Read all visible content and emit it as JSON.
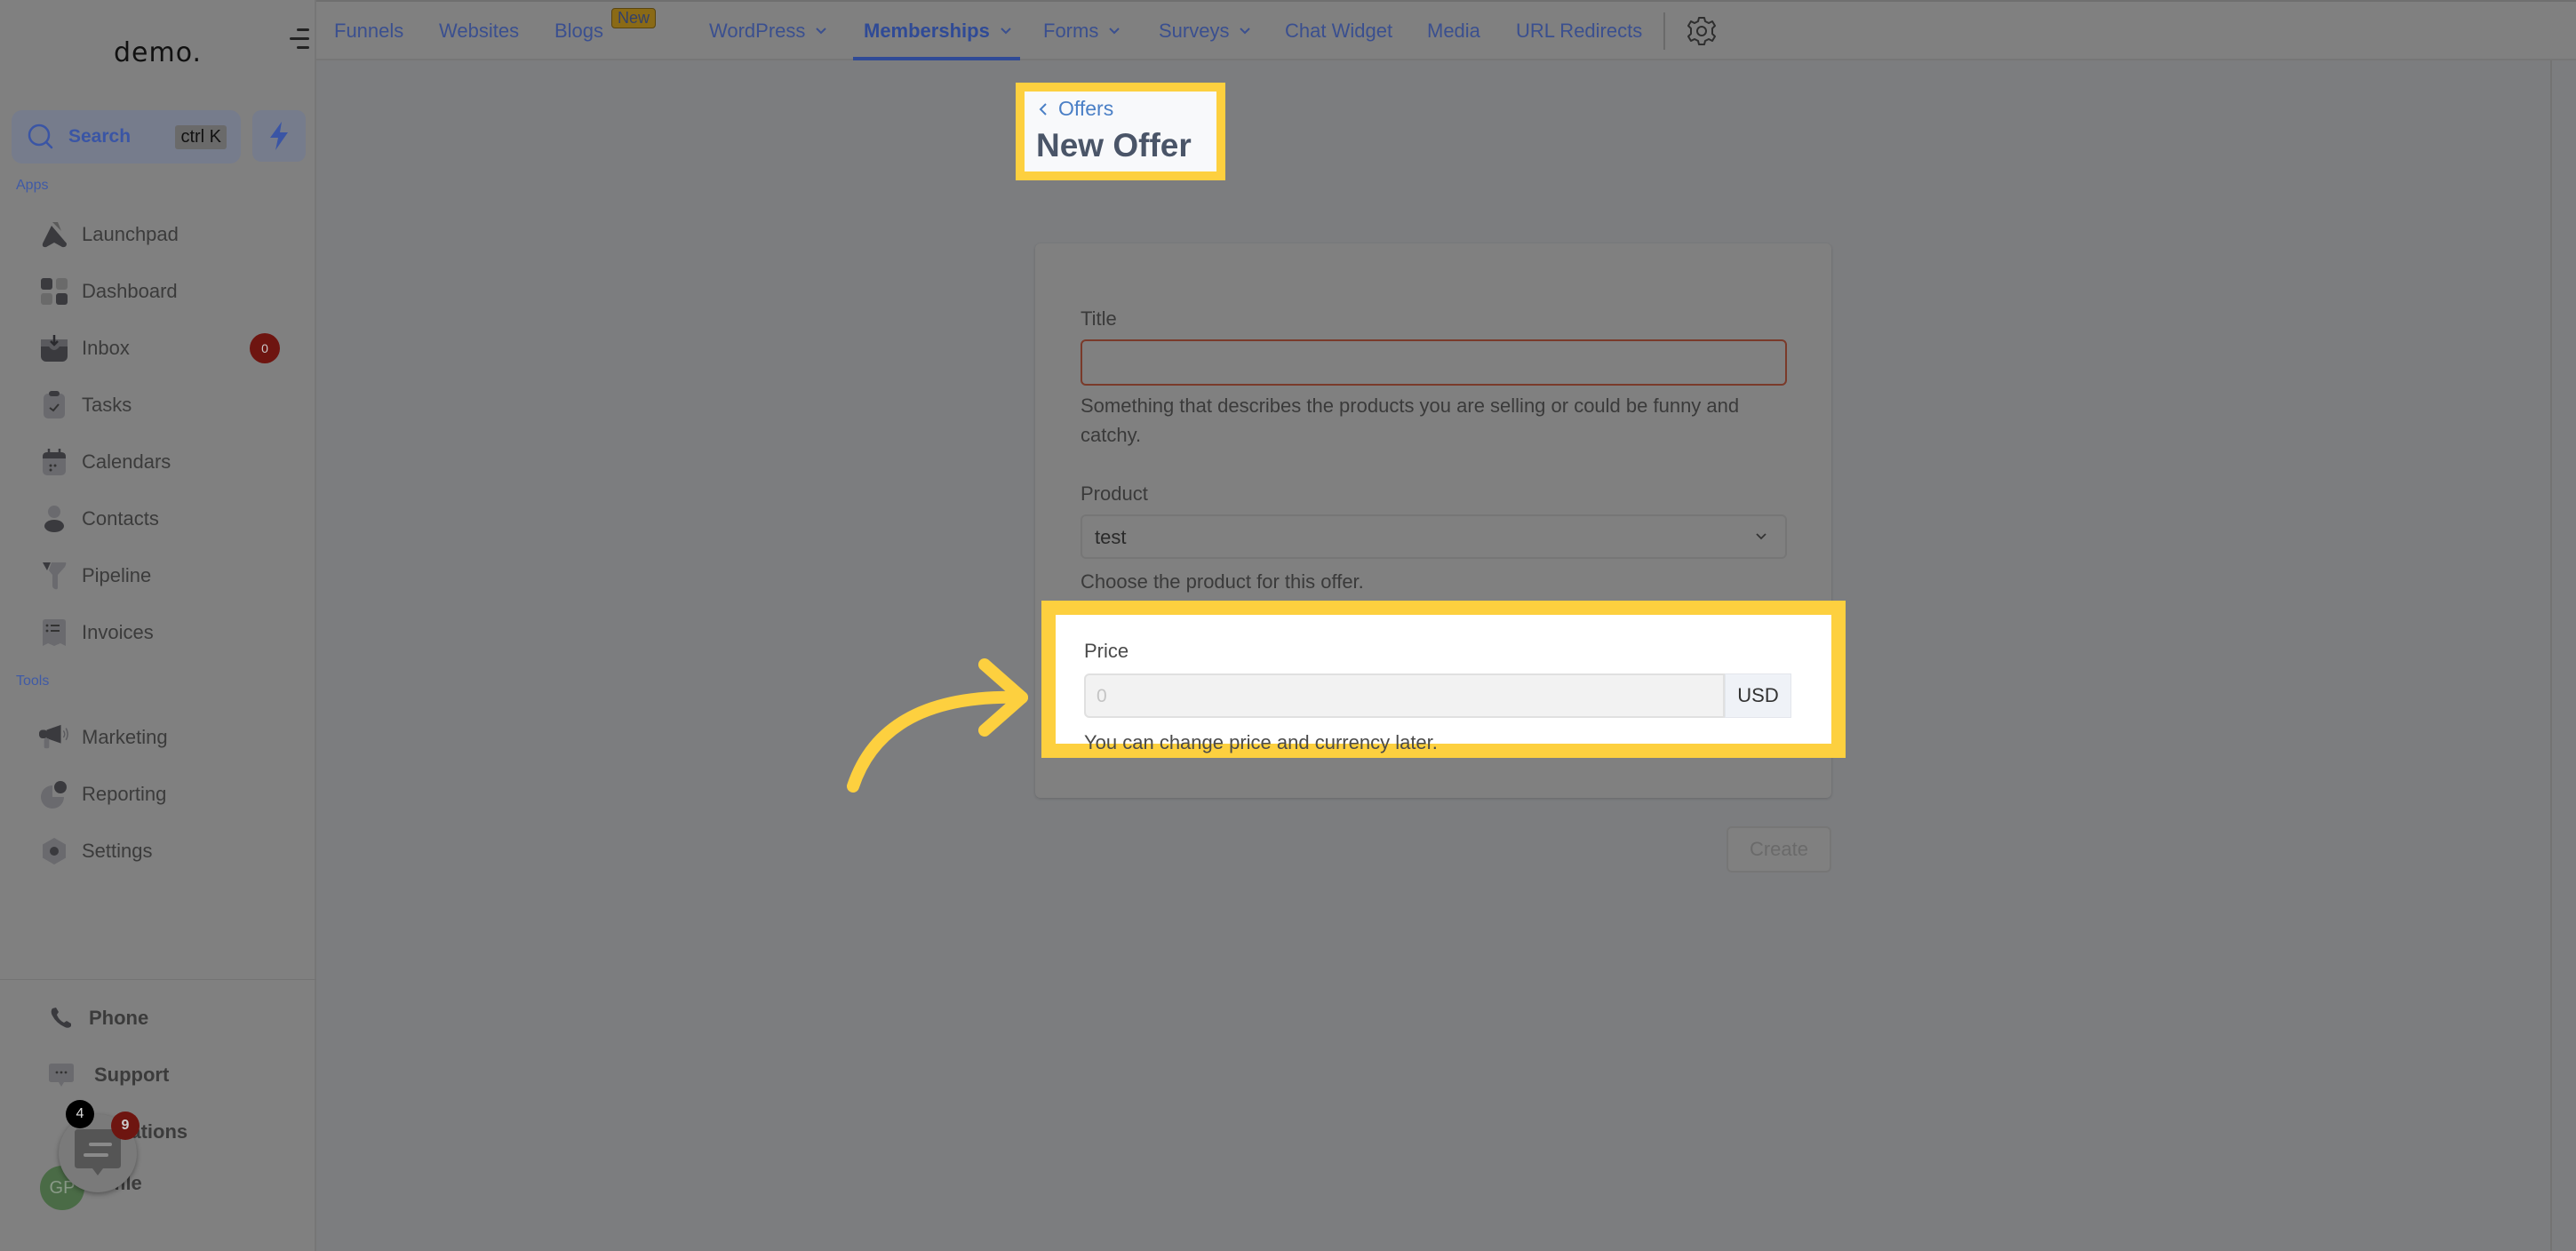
{
  "sidebar": {
    "logo": "demo.",
    "search": {
      "label": "Search",
      "shortcut": "ctrl K"
    },
    "apps_label": "Apps",
    "apps": [
      {
        "label": "Launchpad",
        "icon": "rocket-icon"
      },
      {
        "label": "Dashboard",
        "icon": "grid-icon"
      },
      {
        "label": "Inbox",
        "icon": "inbox-icon",
        "badge": "0"
      },
      {
        "label": "Tasks",
        "icon": "clipboard-icon"
      },
      {
        "label": "Calendars",
        "icon": "calendar-icon"
      },
      {
        "label": "Contacts",
        "icon": "person-icon"
      },
      {
        "label": "Pipeline",
        "icon": "funnel-icon"
      },
      {
        "label": "Invoices",
        "icon": "invoice-icon"
      }
    ],
    "tools_label": "Tools",
    "tools": [
      {
        "label": "Marketing",
        "icon": "megaphone-icon"
      },
      {
        "label": "Reporting",
        "icon": "pie-chart-icon"
      },
      {
        "label": "Settings",
        "icon": "settings-icon"
      }
    ],
    "bottom": [
      {
        "label": "Phone",
        "icon": "phone-icon"
      },
      {
        "label": "Support",
        "icon": "chat-icon"
      },
      {
        "label": "Notifications",
        "icon": "bell-icon",
        "visible_text": "ications"
      },
      {
        "label": "Profile",
        "icon": "avatar",
        "visible_text": "file"
      }
    ],
    "avatar_initials": "GP",
    "notifications_count": "4",
    "chat_widget_count": "9"
  },
  "topnav": {
    "items": [
      {
        "label": "Funnels"
      },
      {
        "label": "Websites"
      },
      {
        "label": "Blogs",
        "badge": "New"
      },
      {
        "label": "WordPress",
        "dropdown": true
      },
      {
        "label": "Memberships",
        "dropdown": true,
        "active": true
      },
      {
        "label": "Forms",
        "dropdown": true
      },
      {
        "label": "Surveys",
        "dropdown": true
      },
      {
        "label": "Chat Widget"
      },
      {
        "label": "Media"
      },
      {
        "label": "URL Redirects"
      }
    ]
  },
  "page": {
    "back_link": "Offers",
    "title": "New Offer"
  },
  "form": {
    "title_label": "Title",
    "title_value": "",
    "title_help": "Something that describes the products you are selling or could be funny and catchy.",
    "product_label": "Product",
    "product_value": "test",
    "product_help": "Choose the product for this offer.",
    "price_label": "Price",
    "price_placeholder": "0",
    "currency": "USD",
    "price_help": "You can change price and currency later.",
    "create_label": "Create"
  },
  "colors": {
    "highlight": "#fdd03f",
    "accent": "#2f4a96",
    "error_border": "#7a3a2a"
  }
}
